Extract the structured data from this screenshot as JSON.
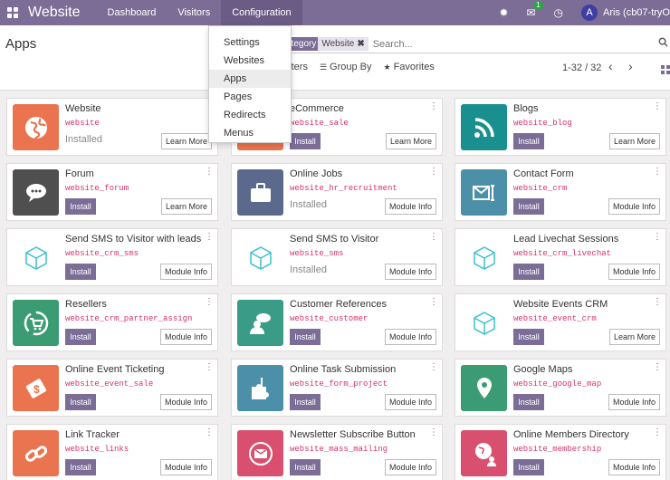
{
  "navbar": {
    "brand": "Website",
    "menu": [
      "Dashboard",
      "Visitors",
      "Configuration"
    ],
    "chat_badge": "1",
    "avatar_letter": "A",
    "user_name": "Aris (cb07-tryO"
  },
  "dropdown": {
    "items": [
      "Settings",
      "Websites",
      "Apps",
      "Pages",
      "Redirects",
      "Menus"
    ]
  },
  "control": {
    "title": "Apps",
    "facet_label": "ategory",
    "facet_value": "Website",
    "search_placeholder": "Search...",
    "filters_label": "Filters",
    "groupby_label": "Group By",
    "favorites_label": "Favorites",
    "pager": "1-32 / 32"
  },
  "apps": [
    {
      "name": "Website",
      "tech": "website",
      "status": "Installed",
      "action": "Learn More",
      "color": "#e9744f",
      "icon": "globe-icon"
    },
    {
      "name": "eCommerce",
      "tech": "website_sale",
      "status": "",
      "action": "Learn More",
      "color": "#e9744f",
      "icon": "cart-icon"
    },
    {
      "name": "Blogs",
      "tech": "website_blog",
      "status": "",
      "action": "Learn More",
      "color": "#1a8f8f",
      "icon": "rss-icon"
    },
    {
      "name": "Forum",
      "tech": "website_forum",
      "status": "",
      "action": "Learn More",
      "color": "#4f4f4f",
      "icon": "chat-bubbles-icon"
    },
    {
      "name": "Online Jobs",
      "tech": "website_hr_recruitment",
      "status": "Installed",
      "action": "Module Info",
      "color": "#5b6a8c",
      "icon": "briefcase-icon"
    },
    {
      "name": "Contact Form",
      "tech": "website_crm",
      "status": "",
      "action": "Module Info",
      "color": "#4b8fa9",
      "icon": "envelope-form-icon"
    },
    {
      "name": "Send SMS to Visitor with leads",
      "tech": "website_crm_sms",
      "status": "",
      "action": "Module Info",
      "color": "#ffffff",
      "icon": "cube-icon"
    },
    {
      "name": "Send SMS to Visitor",
      "tech": "website_sms",
      "status": "Installed",
      "action": "Module Info",
      "color": "#ffffff",
      "icon": "cube-icon"
    },
    {
      "name": "Lead Livechat Sessions",
      "tech": "website_crm_livechat",
      "status": "",
      "action": "Module Info",
      "color": "#ffffff",
      "icon": "cube-icon"
    },
    {
      "name": "Resellers",
      "tech": "website_crm_partner_assign",
      "status": "",
      "action": "Module Info",
      "color": "#3b9c73",
      "icon": "reseller-cart-icon"
    },
    {
      "name": "Customer References",
      "tech": "website_customer",
      "status": "",
      "action": "Module Info",
      "color": "#3a9b86",
      "icon": "customer-chat-icon"
    },
    {
      "name": "Website Events CRM",
      "tech": "website_event_crm",
      "status": "",
      "action": "Learn More",
      "color": "#ffffff",
      "icon": "cube-icon"
    },
    {
      "name": "Online Event Ticketing",
      "tech": "website_event_sale",
      "status": "",
      "action": "Module Info",
      "color": "#e9744f",
      "icon": "ticket-icon"
    },
    {
      "name": "Online Task Submission",
      "tech": "website_form_project",
      "status": "",
      "action": "Module Info",
      "color": "#4b8fa9",
      "icon": "puzzle-icon"
    },
    {
      "name": "Google Maps",
      "tech": "website_google_map",
      "status": "",
      "action": "Module Info",
      "color": "#3b9c73",
      "icon": "map-pin-icon"
    },
    {
      "name": "Link Tracker",
      "tech": "website_links",
      "status": "",
      "action": "Module Info",
      "color": "#e9744f",
      "icon": "link-icon"
    },
    {
      "name": "Newsletter Subscribe Button",
      "tech": "website_mass_mailing",
      "status": "",
      "action": "Module Info",
      "color": "#d94f6f",
      "icon": "mail-icon"
    },
    {
      "name": "Online Members Directory",
      "tech": "website_membership",
      "status": "",
      "action": "Module Info",
      "color": "#d94f6f",
      "icon": "members-globe-icon"
    }
  ]
}
